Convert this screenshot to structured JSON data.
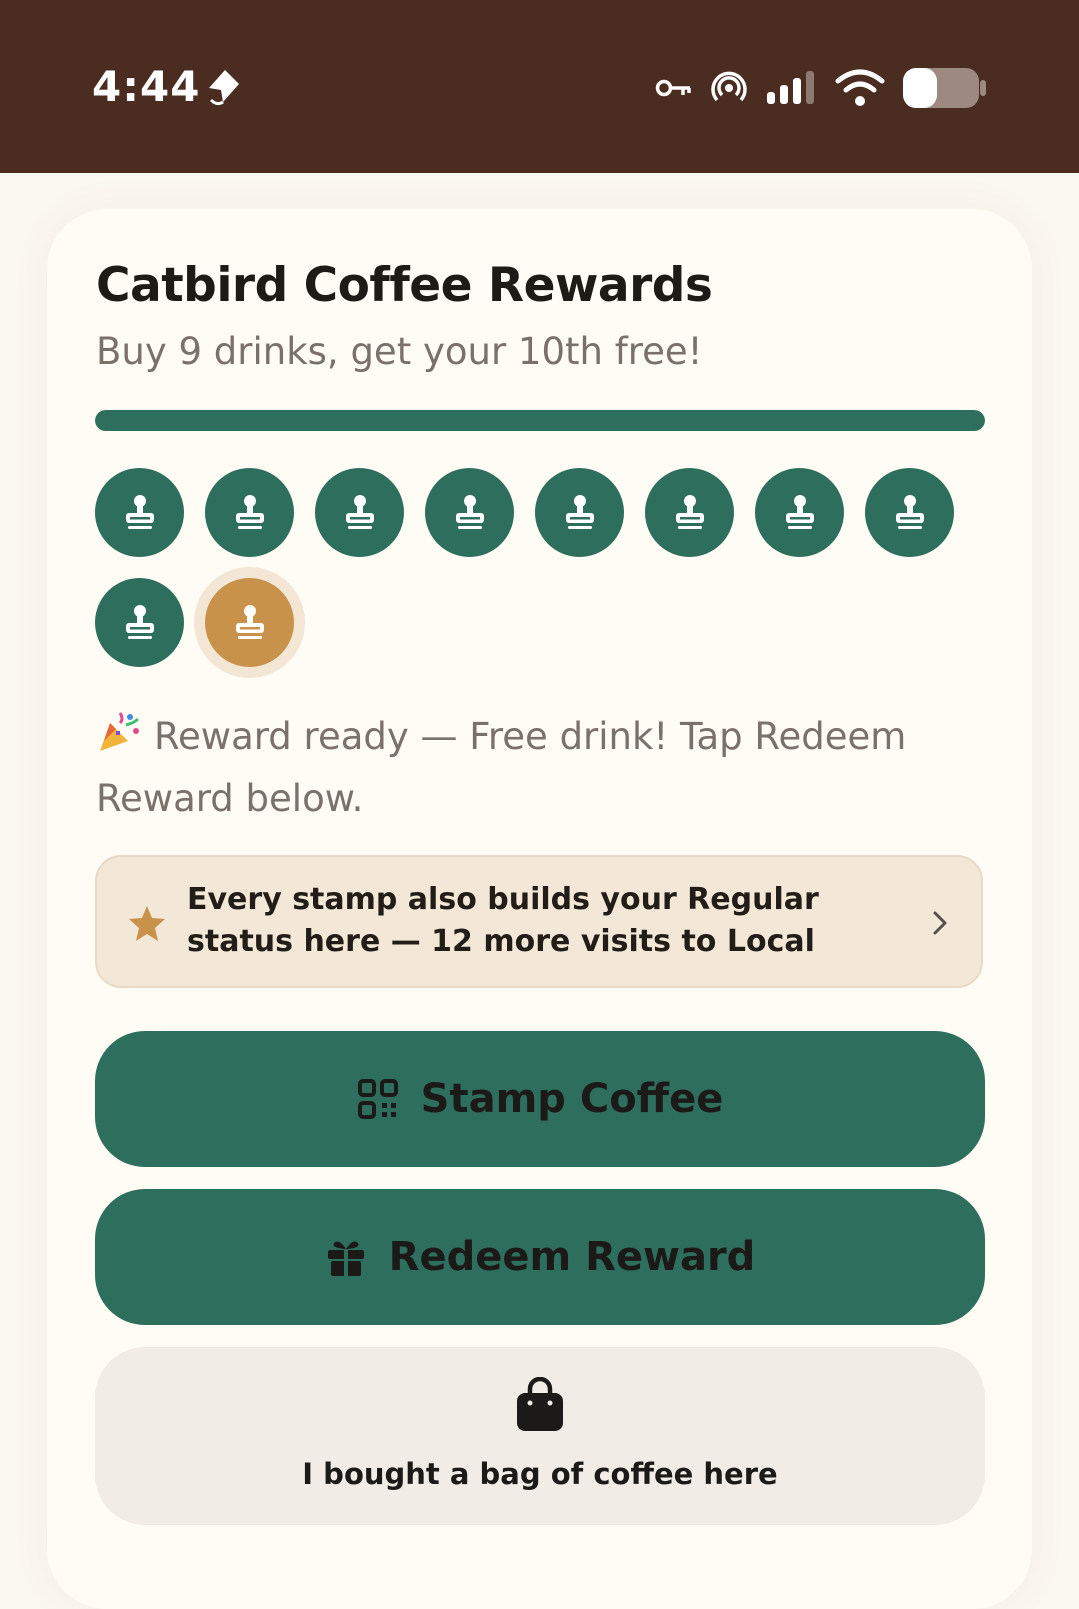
{
  "status_bar": {
    "time": "4:44",
    "icons": [
      "navigation-arrow-icon",
      "vpn-key-icon",
      "hotspot-icon",
      "signal-icon",
      "wifi-icon",
      "battery-icon"
    ],
    "battery_level": 0.45
  },
  "rewards_card": {
    "title": "Catbird Coffee Rewards",
    "subtitle": "Buy 9 drinks, get your 10th free!",
    "progress": 1.0,
    "stamps_total": 10,
    "stamps_filled": 9,
    "reward_message": "Reward ready — Free drink! Tap Redeem Reward below."
  },
  "regular_banner": {
    "text": "Every stamp also builds your Regular status here — 12 more visits to Local"
  },
  "buttons": {
    "stamp_coffee": "Stamp Coffee",
    "redeem_reward": "Redeem Reward",
    "bought_bag": "I bought a bag of coffee here"
  },
  "colors": {
    "status_bar": "#4a2c21",
    "accent_green": "#2e6e5c",
    "reward_gold": "#c9924a",
    "banner_bg": "#f3e7d8",
    "page_bg": "#fbf8f1"
  }
}
